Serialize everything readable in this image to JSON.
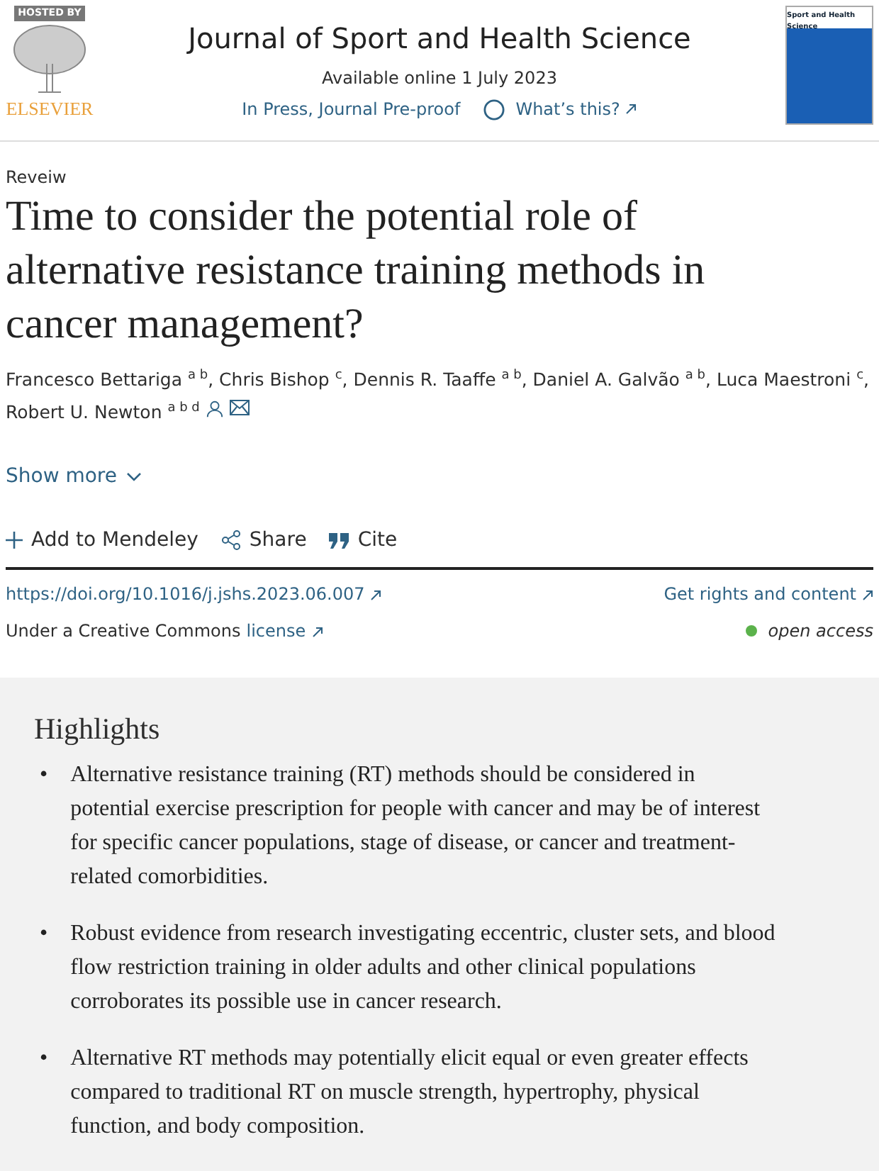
{
  "publisher": {
    "badge": "HOSTED BY",
    "name": "ELSEVIER"
  },
  "journal": {
    "title": "Journal of Sport and Health Science",
    "available": "Available online 1 July 2023",
    "status_link": "In Press, Journal Pre-proof",
    "help_link": "What’s this?",
    "cover_title": "Sport and Health Science"
  },
  "article": {
    "type": "Reveiw",
    "title": "Time to consider the potential role of alternative resistance training methods in cancer management?",
    "authors": [
      {
        "name": "Francesco Bettariga",
        "affiliations": "a b",
        "corresponding": false,
        "separator": ","
      },
      {
        "name": "Chris Bishop",
        "affiliations": "c",
        "corresponding": false,
        "separator": ","
      },
      {
        "name": "Dennis R. Taaffe",
        "affiliations": "a b",
        "corresponding": false,
        "separator": ","
      },
      {
        "name": "Daniel A. Galvão",
        "affiliations": "a b",
        "corresponding": false,
        "separator": ","
      },
      {
        "name": "Luca Maestroni",
        "affiliations": "c",
        "corresponding": false,
        "separator": ","
      },
      {
        "name": "Robert U. Newton",
        "affiliations": "a b d",
        "corresponding": true
      }
    ],
    "show_more": "Show more",
    "actions": [
      {
        "kind": "add",
        "label": "Add to Mendeley"
      },
      {
        "kind": "share",
        "label": "Share"
      },
      {
        "kind": "cite",
        "label": "Cite"
      }
    ],
    "doi": "https://doi.org/10.1016/j.jshs.2023.06.007",
    "rights": "Get rights and content",
    "license_text": "Under a Creative Commons",
    "license_link": "license",
    "access": {
      "label": "open access",
      "color": "#5bb24b"
    }
  },
  "highlights": {
    "title": "Highlights",
    "bullet": "•",
    "items": [
      "Alternative resistance training (RT) methods should be considered in potential exercise prescription for people with cancer and may be of interest for specific cancer populations, stage of disease, or cancer and treatment-related comorbidities.",
      "Robust evidence from research investigating eccentric, cluster sets, and blood flow restriction training in older adults and other clinical populations corroborates its possible use in cancer research.",
      "Alternative RT methods may potentially elicit equal or even greater effects compared to traditional RT on muscle strength, hypertrophy, physical function, and body composition."
    ]
  }
}
